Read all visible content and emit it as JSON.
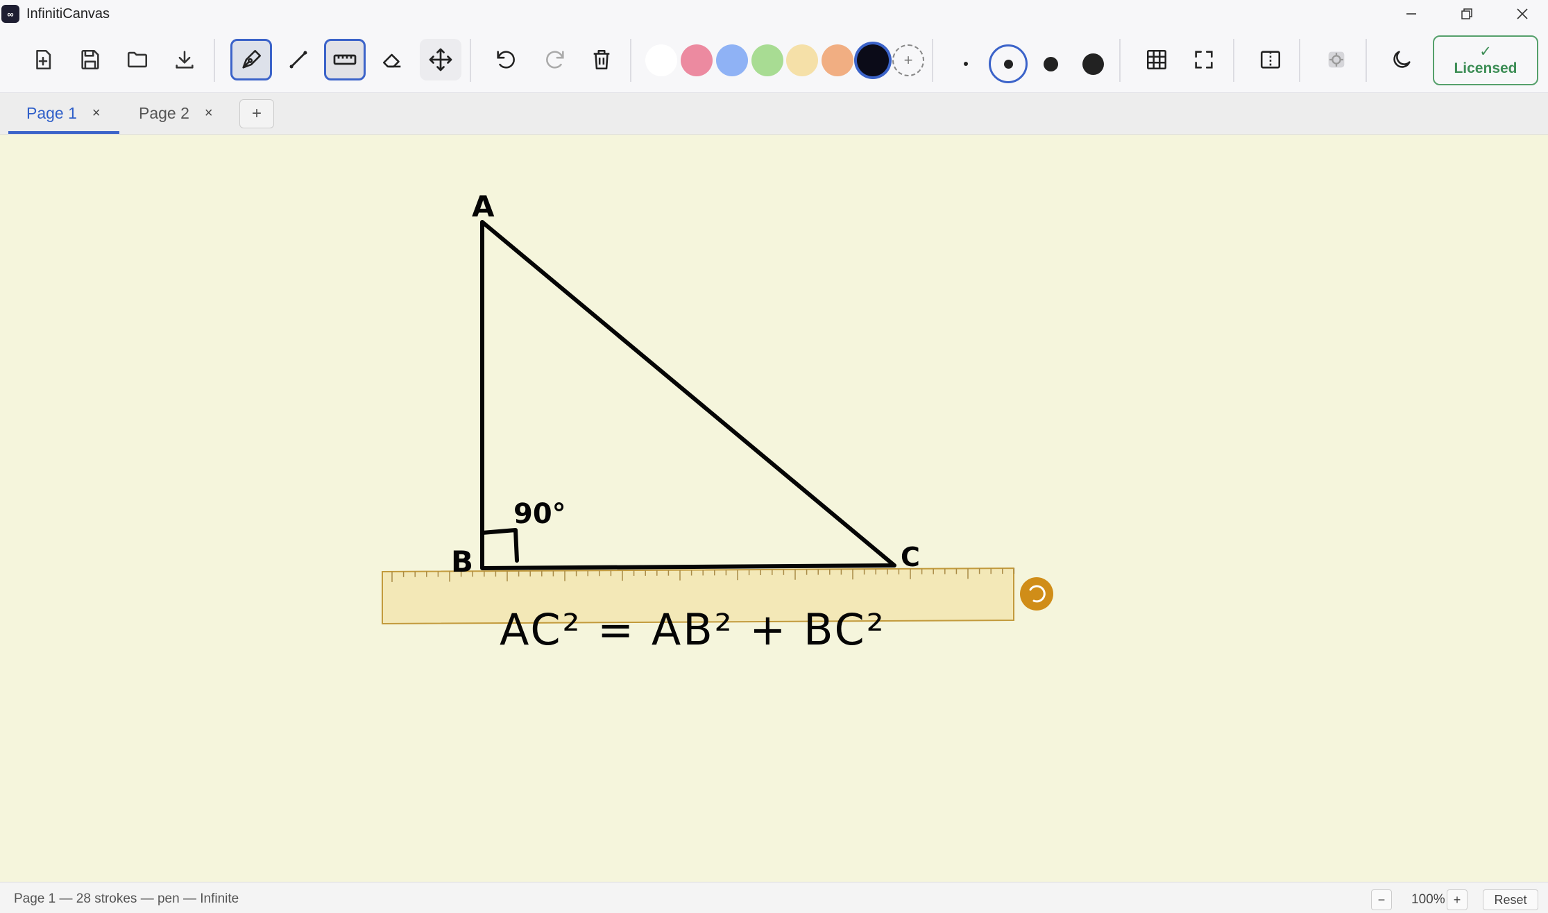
{
  "app": {
    "title": "InfinitiCanvas",
    "icon_glyph": "∞"
  },
  "window_controls": {
    "minimize": "minimize-icon",
    "restore": "restore-icon",
    "close": "close-icon"
  },
  "toolbar": {
    "tools": [
      "new-page",
      "save",
      "open",
      "export",
      "pen",
      "line",
      "ruler",
      "eraser",
      "pan",
      "undo",
      "redo",
      "delete"
    ],
    "active_tool": "pen",
    "ruler_active": true,
    "colors": [
      "#ffffff",
      "#ec8aa0",
      "#8fb2f5",
      "#a8dc93",
      "#f5e0a8",
      "#f1ae82",
      "#0b0b18"
    ],
    "selected_color": "#0b0b18",
    "add_color_label": "+",
    "sizes": [
      "xs",
      "s",
      "m",
      "l"
    ],
    "selected_size": "s",
    "licensed_check": "✓",
    "licensed_label": "Licensed"
  },
  "tabs": [
    {
      "label": "Page 1",
      "close": "×",
      "active": true
    },
    {
      "label": "Page 2",
      "close": "×",
      "active": false
    }
  ],
  "add_tab_label": "+",
  "canvas": {
    "background": "#f5f5dc",
    "labels": {
      "a": "A",
      "b": "B",
      "c": "C",
      "angle": "90°"
    },
    "equation": "AC² = AB² + BC²"
  },
  "status": {
    "text": "Page 1 — 28 strokes — pen — Infinite",
    "zoom": "100%",
    "zoom_out": "−",
    "zoom_in": "+",
    "reset": "Reset"
  }
}
